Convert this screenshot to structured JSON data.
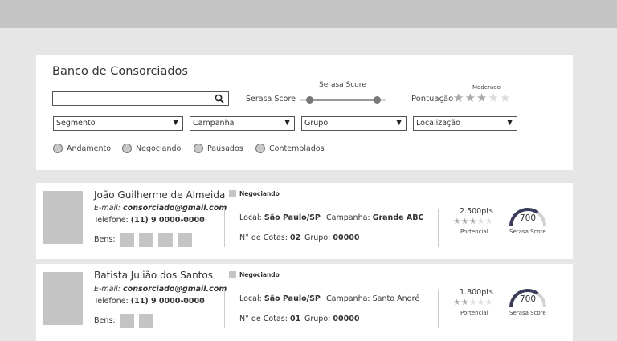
{
  "filters": {
    "title": "Banco de Consorciados",
    "search_placeholder": "",
    "serasa_header": "Serasa Score",
    "serasa_label": "Serasa Score",
    "pontuacao_header": "Moderado",
    "pontuacao_label": "Pontuação",
    "pontuacao_rating": 3,
    "pontuacao_max": 5,
    "serasa_range_fraction": [
      0.1,
      0.9
    ],
    "selects": [
      {
        "label": "Segmento"
      },
      {
        "label": "Campanha"
      },
      {
        "label": "Grupo"
      },
      {
        "label": "Localização"
      }
    ],
    "status_options": [
      "Andamento",
      "Negociando",
      "Pausados",
      "Contemplados"
    ]
  },
  "labels": {
    "email_prefix": "E-mail:",
    "phone_prefix": "Telefone:",
    "bens": "Bens:",
    "local": "Local:",
    "campanha": "Campanha:",
    "cotas": "N° de Cotas:",
    "grupo": "Grupo:",
    "potencial": "Portencial",
    "serasa": "Serasa Score"
  },
  "consorciados": [
    {
      "name": "João Guilherme de Almeida",
      "status": "Negociando",
      "email": "consorciado@gmail.com",
      "phone": "(11) 9 0000-0000",
      "bens_count": 4,
      "local": "São Paulo/SP",
      "campanha": "Grande ABC",
      "cotas": "02",
      "grupo": "00000",
      "points": "2.500pts",
      "potencial_rating": 3,
      "serasa_score": "700",
      "serasa_fraction": 0.7
    },
    {
      "name": "Batista Julião dos Santos",
      "status": "Negociando",
      "email": "consorciado@gmail.com",
      "phone": "(11) 9 0000-0000",
      "bens_count": 2,
      "local": "São Paulo/SP",
      "campanha": "Santo André",
      "cotas": "01",
      "grupo": "00000",
      "points": "1.800pts",
      "potencial_rating": 2,
      "serasa_score": "700",
      "serasa_fraction": 0.7
    }
  ]
}
